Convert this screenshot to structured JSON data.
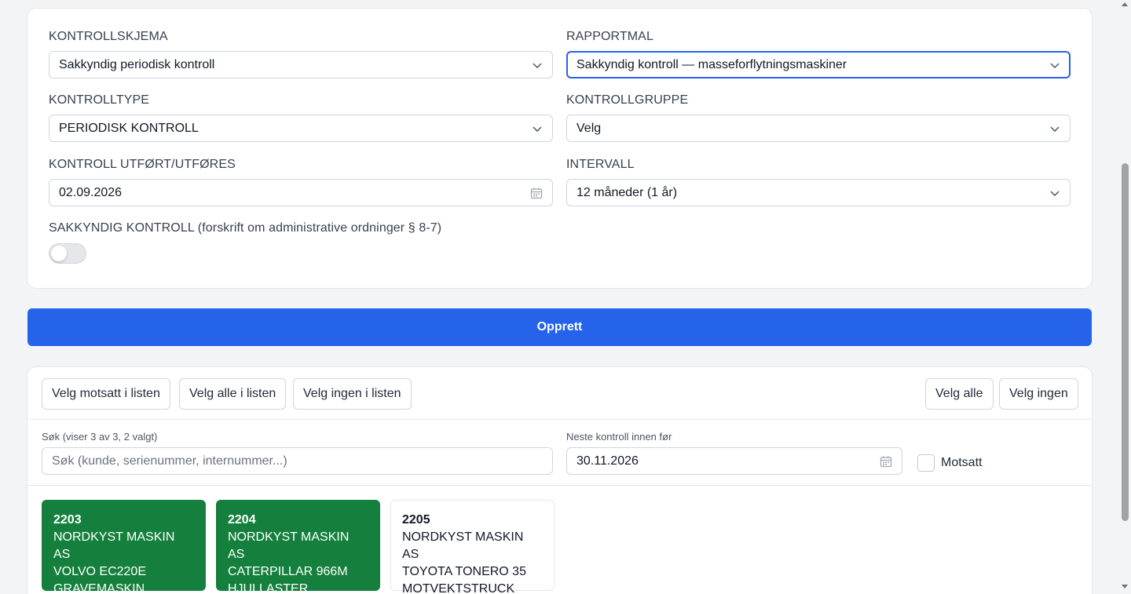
{
  "form": {
    "kontrollskjema": {
      "label": "KONTROLLSKJEMA",
      "value": "Sakkyndig periodisk kontroll"
    },
    "rapportmal": {
      "label": "RAPPORTMAL",
      "value": "Sakkyndig kontroll — masseforflytningsmaskiner"
    },
    "kontrolltype": {
      "label": "KONTROLLTYPE",
      "value": "PERIODISK KONTROLL"
    },
    "kontrollgruppe": {
      "label": "KONTROLLGRUPPE",
      "value": "Velg"
    },
    "kontroll_utfort": {
      "label": "KONTROLL UTFØRT/UTFØRES",
      "value": "02.09.2026"
    },
    "intervall": {
      "label": "INTERVALL",
      "value": "12 måneder (1 år)"
    },
    "sakkyndig": {
      "label": "SAKKYNDIG KONTROLL (forskrift om administrative ordninger § 8-7)",
      "on": false
    }
  },
  "create_button": "Opprett",
  "list": {
    "buttons": {
      "invert": "Velg motsatt i listen",
      "select_all_list": "Velg alle i listen",
      "select_none_list": "Velg ingen i listen",
      "select_all": "Velg alle",
      "select_none": "Velg ingen"
    },
    "search": {
      "label": "Søk (viser 3 av 3, 2 valgt)",
      "placeholder": "Søk (kunde, serienummer, internummer...)"
    },
    "next_control": {
      "label": "Neste kontroll innen før",
      "value": "30.11.2026"
    },
    "motsatt": {
      "label": "Motsatt",
      "checked": false
    },
    "items": [
      {
        "number": "2203",
        "customer": "NORDKYST MASKIN AS",
        "model": "VOLVO EC220E",
        "type": "GRAVEMASKIN",
        "selected": true
      },
      {
        "number": "2204",
        "customer": "NORDKYST MASKIN AS",
        "model": "CATERPILLAR 966M",
        "type": "HJULLASTER",
        "selected": true
      },
      {
        "number": "2205",
        "customer": "NORDKYST MASKIN AS",
        "model": "TOYOTA TONERO 35",
        "type": "MOTVEKTSTRUCK",
        "selected": false
      }
    ]
  },
  "colors": {
    "primary": "#2563eb",
    "selected_item": "#15803d",
    "border": "#d1d5db"
  },
  "icons": {
    "select": "chevron-down-icon",
    "date": "calendar-icon"
  }
}
